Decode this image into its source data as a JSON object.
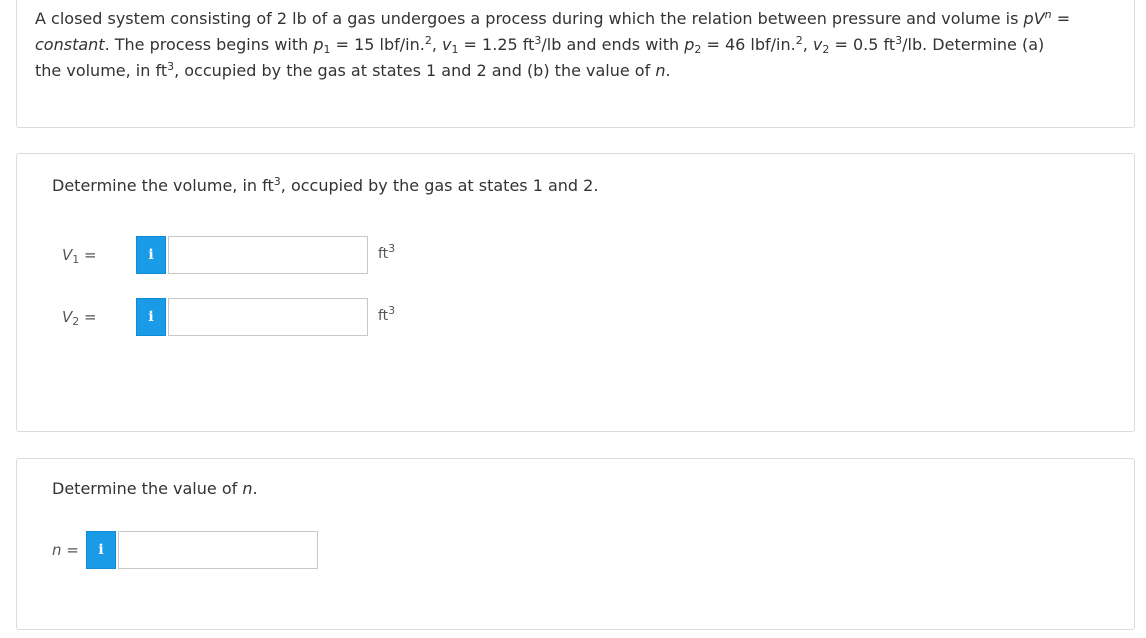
{
  "problem": {
    "t1": "A closed system consisting of 2 lb of a gas undergoes a process during which the relation between pressure and volume is ",
    "p": "pV",
    "n_sup": "n",
    "eq": " = ",
    "constant": "constant",
    "t2": ". The process begins with ",
    "p1": "p",
    "p1_sub": "1",
    "t3": " = 15 lbf/in.",
    "sq1": "2",
    "t4": ", ",
    "v1": "v",
    "v1_sub": "1",
    "t5": " = 1.25 ft",
    "cube1": "3",
    "t6": "/lb and ends with ",
    "p2": "p",
    "p2_sub": "2",
    "t7": " = 46 lbf/in.",
    "sq2": "2",
    "t8": ", ",
    "v2": "v",
    "v2_sub": "2",
    "t9": " = 0.5 ft",
    "cube2": "3",
    "t10": "/lb. Determine (a) the volume, in ft",
    "cube3": "3",
    "t11": ", occupied by the gas at states 1 and 2 and (b) the value of ",
    "n_end": "n",
    "t12": "."
  },
  "part_a": {
    "prompt_pre": "Determine the volume, in ft",
    "prompt_sup": "3",
    "prompt_post": ", occupied by the gas at states 1 and 2.",
    "rows": [
      {
        "var": "V",
        "sub": "1",
        "eq": " =",
        "info": "i",
        "value": "",
        "unit": "ft",
        "unit_sup": "3"
      },
      {
        "var": "V",
        "sub": "2",
        "eq": " =",
        "info": "i",
        "value": "",
        "unit": "ft",
        "unit_sup": "3"
      }
    ]
  },
  "part_b": {
    "prompt_pre": "Determine the value of ",
    "prompt_var": "n",
    "prompt_post": ".",
    "row": {
      "var": "n",
      "eq": " =",
      "info": "i",
      "value": ""
    }
  },
  "colors": {
    "info_button": "#1a9be8",
    "border": "#dcdcdc",
    "text": "#333333"
  }
}
